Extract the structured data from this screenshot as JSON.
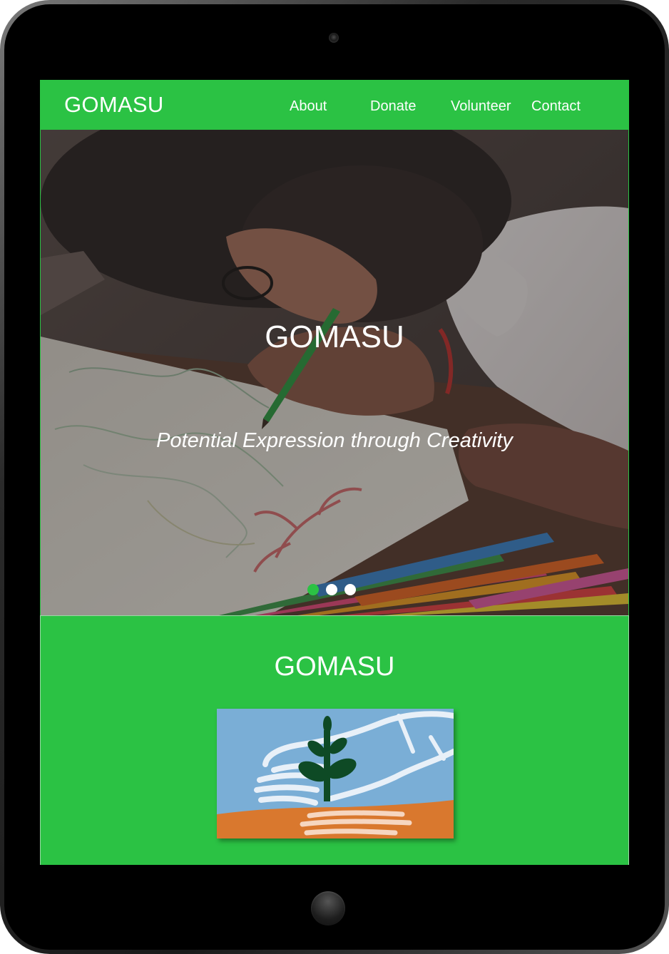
{
  "nav": {
    "brand": "GOMASU",
    "links": [
      "About",
      "Donate",
      "Volunteer",
      "Contact"
    ]
  },
  "hero": {
    "title": "GOMASU",
    "tagline": "Potential Expression through Creativity",
    "slides": {
      "count": 3,
      "active_index": 0
    }
  },
  "about": {
    "title": "GOMASU"
  },
  "colors": {
    "accent_green": "#2bc244",
    "device_frame": "#000000",
    "logo_sky": "#7aaed6",
    "logo_soil": "#d9782e",
    "logo_plant": "#0e4a25"
  },
  "icons": {
    "camera": "camera-icon",
    "home": "home-button-icon",
    "logo": "plant-in-hands-logo"
  }
}
